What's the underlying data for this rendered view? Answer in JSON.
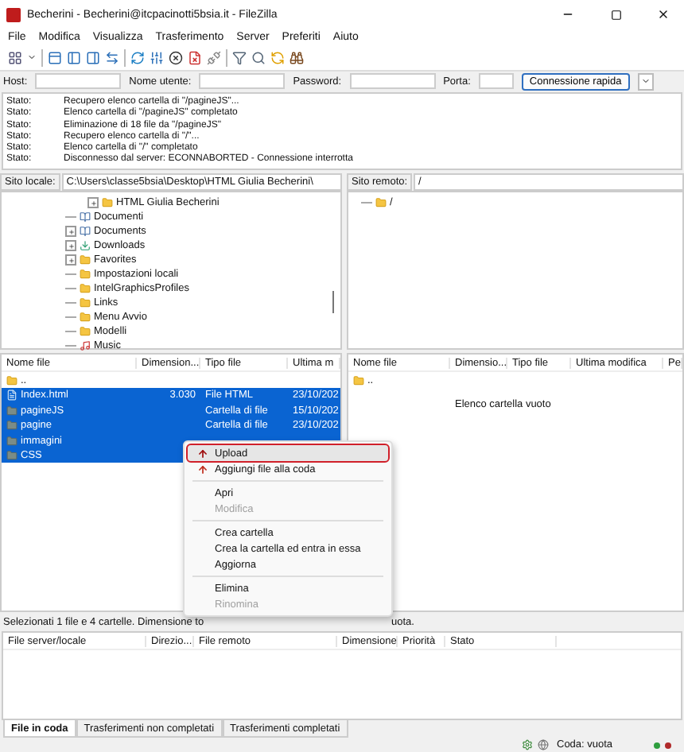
{
  "window": {
    "title": "Becherini - Becherini@itcpacinotti5bsia.it - FileZilla"
  },
  "menu_bar": [
    "File",
    "Modifica",
    "Visualizza",
    "Trasferimento",
    "Server",
    "Preferiti",
    "Aiuto"
  ],
  "quickconnect": {
    "host_label": "Host:",
    "user_label": "Nome utente:",
    "password_label": "Password:",
    "port_label": "Porta:",
    "button": "Connessione rapida"
  },
  "log": [
    {
      "label": "Stato:",
      "message": "Recupero elenco cartella di \"/pagineJS\"..."
    },
    {
      "label": "Stato:",
      "message": "Elenco cartella di \"/pagineJS\" completato"
    },
    {
      "label": "Stato:",
      "message": "Eliminazione di 18 file da \"/pagineJS\""
    },
    {
      "label": "Stato:",
      "message": "Recupero elenco cartella di \"/\"..."
    },
    {
      "label": "Stato:",
      "message": "Elenco cartella di \"/\" completato"
    },
    {
      "label": "Stato:",
      "message": "Disconnesso dal server: ECONNABORTED - Connessione interrotta"
    }
  ],
  "local_site": {
    "label": "Sito locale:",
    "path": "C:\\Users\\classe5bsia\\Desktop\\HTML Giulia Becherini\\"
  },
  "remote_site": {
    "label": "Sito remoto:",
    "path": "/"
  },
  "local_tree": [
    {
      "children": [
        {
          "name": "HTML Giulia Becherini",
          "kind": "folder",
          "expandable": true
        }
      ]
    },
    {
      "name": "Documenti",
      "kind": "library",
      "expandable": false
    },
    {
      "name": "Documents",
      "kind": "library",
      "expandable": true
    },
    {
      "name": "Downloads",
      "kind": "download",
      "expandable": true
    },
    {
      "name": "Favorites",
      "kind": "folder",
      "expandable": true
    },
    {
      "name": "Impostazioni locali",
      "kind": "folder",
      "expandable": false
    },
    {
      "name": "IntelGraphicsProfiles",
      "kind": "folder",
      "expandable": false
    },
    {
      "name": "Links",
      "kind": "folder",
      "expandable": false
    },
    {
      "name": "Menu Avvio",
      "kind": "folder",
      "expandable": false
    },
    {
      "name": "Modelli",
      "kind": "folder",
      "expandable": false
    },
    {
      "name": "Music",
      "kind": "music",
      "expandable": false
    }
  ],
  "remote_tree": [
    {
      "name": "/",
      "kind": "folder",
      "expandable": false
    }
  ],
  "local_files": {
    "columns": [
      "Nome file",
      "Dimension...",
      "Tipo file",
      "Ultima m"
    ],
    "rows": [
      {
        "kind": "parent",
        "name": "..",
        "selected": false
      },
      {
        "kind": "file",
        "name": "Index.html",
        "size": "3.030",
        "type": "File HTML",
        "modified": "23/10/202",
        "selected": true
      },
      {
        "kind": "folder",
        "name": "pagineJS",
        "type": "Cartella di file",
        "modified": "15/10/202",
        "selected": true
      },
      {
        "kind": "folder",
        "name": "pagine",
        "type": "Cartella di file",
        "modified": "23/10/202",
        "selected": true
      },
      {
        "kind": "folder",
        "name": "immagini",
        "selected": true
      },
      {
        "kind": "folder",
        "name": "CSS",
        "selected": true
      }
    ]
  },
  "remote_files": {
    "columns": [
      "Nome file",
      "Dimensio...",
      "Tipo file",
      "Ultima modifica",
      "Pe"
    ],
    "rows": [
      {
        "kind": "parent",
        "name": ".."
      }
    ],
    "empty_message": "Elenco cartella vuoto"
  },
  "context_menu": [
    {
      "kind": "item",
      "label": "Upload",
      "highlighted": true,
      "disabled": false
    },
    {
      "kind": "item",
      "label": "Aggiungi file alla coda",
      "highlighted": false,
      "disabled": false
    },
    {
      "kind": "separator"
    },
    {
      "kind": "item",
      "label": "Apri",
      "highlighted": false,
      "disabled": false
    },
    {
      "kind": "item",
      "label": "Modifica",
      "highlighted": false,
      "disabled": true
    },
    {
      "kind": "separator"
    },
    {
      "kind": "item",
      "label": "Crea cartella",
      "highlighted": false,
      "disabled": false
    },
    {
      "kind": "item",
      "label": "Crea la cartella ed entra in essa",
      "highlighted": false,
      "disabled": false
    },
    {
      "kind": "item",
      "label": "Aggiorna",
      "highlighted": false,
      "disabled": false
    },
    {
      "kind": "separator"
    },
    {
      "kind": "item",
      "label": "Elimina",
      "highlighted": false,
      "disabled": false
    },
    {
      "kind": "item",
      "label": "Rinomina",
      "highlighted": false,
      "disabled": true
    }
  ],
  "local_status": "Selezionati 1 file e 4 cartelle. Dimensione to",
  "remote_status": "uota.",
  "queue": {
    "columns": [
      "File server/locale",
      "Direzio...",
      "File remoto",
      "Dimensione",
      "Priorità",
      "Stato"
    ]
  },
  "queue_tabs": [
    {
      "label": "File in coda",
      "selected": true
    },
    {
      "label": "Trasferimenti non completati",
      "selected": false
    },
    {
      "label": "Trasferimenti completati",
      "selected": false
    }
  ],
  "status_bar": {
    "queue": "Coda: vuota"
  }
}
